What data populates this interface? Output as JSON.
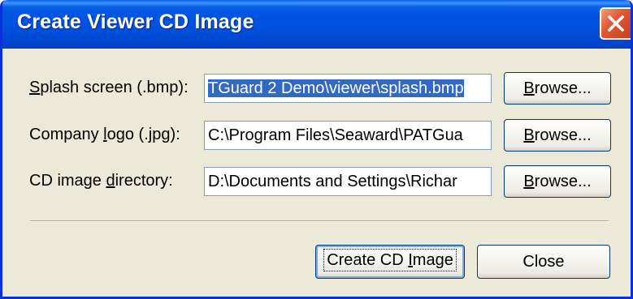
{
  "window": {
    "title": "Create Viewer CD Image",
    "close_icon": "close-x-icon"
  },
  "fields": [
    {
      "label_pre": "",
      "label_mn": "S",
      "label_post": "plash screen (.bmp):",
      "value": "TGuard 2 Demo\\viewer\\splash.bmp",
      "selected": true
    },
    {
      "label_pre": "Company ",
      "label_mn": "l",
      "label_post": "ogo (.jpg):",
      "value": "C:\\Program Files\\Seaward\\PATGua",
      "selected": false
    },
    {
      "label_pre": "CD image ",
      "label_mn": "d",
      "label_post": "irectory:",
      "value": "D:\\Documents and Settings\\Richar",
      "selected": false
    }
  ],
  "browse": {
    "mn": "B",
    "rest": "rowse..."
  },
  "actions": {
    "create_pre": "Create CD ",
    "create_mn": "I",
    "create_post": "mage",
    "close": "Close"
  },
  "colors": {
    "titlebar": "#0054E3",
    "window_bg": "#ECE9D8",
    "selection": "#316AC5",
    "close_button": "#E25A34"
  }
}
